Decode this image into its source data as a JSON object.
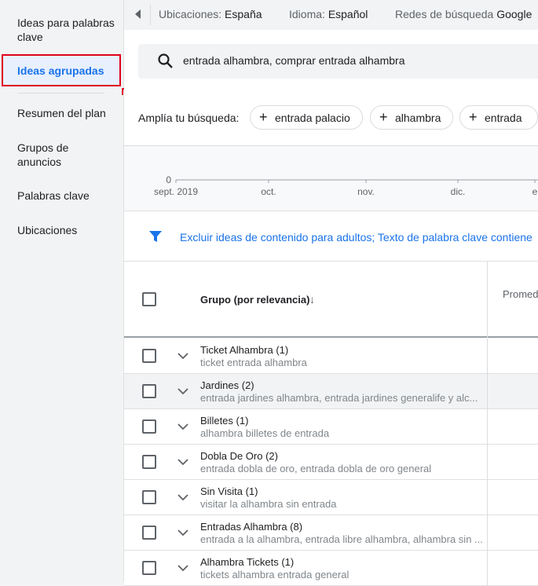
{
  "sidebar": {
    "items": [
      {
        "label": "Ideas para palabras clave"
      },
      {
        "label": "Ideas agrupadas"
      },
      {
        "label": "Resumen del plan"
      },
      {
        "label": "Grupos de anuncios"
      },
      {
        "label": "Palabras clave"
      },
      {
        "label": "Ubicaciones"
      }
    ]
  },
  "topbar": {
    "location_label": "Ubicaciones:",
    "location_value": "España",
    "language_label": "Idioma:",
    "language_value": "Español",
    "network_label": "Redes de búsqueda",
    "network_value": "Google"
  },
  "search": {
    "query": "entrada alhambra, comprar entrada alhambra",
    "expand_label": "Amplía tu búsqueda:",
    "chips": [
      "entrada palacio",
      "alhambra",
      "entrada"
    ]
  },
  "chart_data": {
    "type": "line",
    "x_ticks": [
      "sept. 2019",
      "oct.",
      "nov.",
      "dic.",
      "e"
    ],
    "y_ticks": [
      "0"
    ]
  },
  "filters": {
    "text": "Excluir ideas de contenido para adultos;  Texto de palabra clave contiene"
  },
  "table": {
    "header_group": "Grupo (por relevancia)",
    "header_avg": "Promed",
    "rows": [
      {
        "title": "Ticket Alhambra (1)",
        "subtitle": "ticket entrada alhambra"
      },
      {
        "title": "Jardines (2)",
        "subtitle": "entrada jardines alhambra, entrada jardines generalife y alc..."
      },
      {
        "title": "Billetes (1)",
        "subtitle": "alhambra billetes de entrada"
      },
      {
        "title": "Dobla De Oro (2)",
        "subtitle": "entrada dobla de oro, entrada dobla de oro general"
      },
      {
        "title": "Sin Visita (1)",
        "subtitle": "visitar la alhambra sin entrada"
      },
      {
        "title": "Entradas Alhambra (8)",
        "subtitle": "entrada a la alhambra, entrada libre alhambra, alhambra sin ..."
      },
      {
        "title": "Alhambra Tickets (1)",
        "subtitle": "tickets alhambra entrada general"
      }
    ]
  },
  "colors": {
    "accent": "#1a73e8",
    "highlight_border": "#e0001b"
  }
}
